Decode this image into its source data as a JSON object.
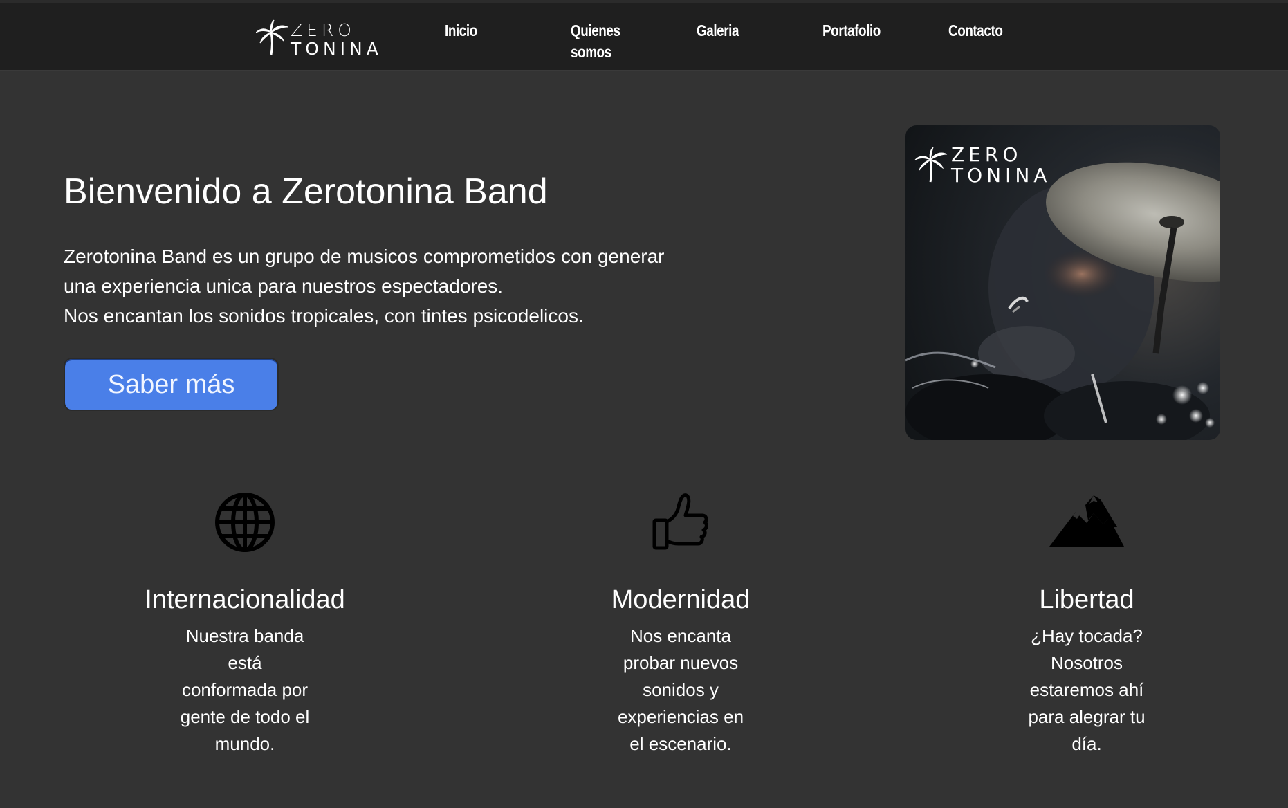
{
  "nav": {
    "brand": {
      "line1": "ZERO",
      "line2": "TONINA"
    },
    "items": [
      {
        "label": "Inicio"
      },
      {
        "label": "Quienes somos",
        "lines": [
          "Quienes",
          "somos"
        ]
      },
      {
        "label": "Galeria"
      },
      {
        "label": "Portafolio"
      },
      {
        "label": "Contacto"
      }
    ]
  },
  "hero": {
    "title": "Bienvenido a Zerotonina Band",
    "paragraph_lines": [
      "Zerotonina Band es un grupo de musicos comprometidos con generar",
      "una experiencia unica para nuestros espectadores.",
      "Nos encantan los sonidos tropicales, con tintes psicodelicos."
    ],
    "button_label": "Saber más",
    "photo_logo": {
      "line1": "ZERO",
      "line2": "TONINA"
    }
  },
  "features": [
    {
      "icon": "globe-icon",
      "title": "Internacionalidad",
      "text_lines": [
        "Nuestra banda",
        "está",
        "conformada por",
        "gente de todo el",
        "mundo."
      ]
    },
    {
      "icon": "thumbs-up-icon",
      "title": "Modernidad",
      "text_lines": [
        "Nos encanta",
        "probar nuevos",
        "sonidos y",
        "experiencias en",
        "el escenario."
      ]
    },
    {
      "icon": "mountains-icon",
      "title": "Libertad",
      "text_lines": [
        "¿Hay tocada?",
        "Nosotros",
        "estaremos ahí",
        "para alegrar tu",
        "día."
      ]
    }
  ],
  "colors": {
    "page_background": "#333333",
    "nav_background": "#1f1f1f",
    "button_blue": "#4a7fe8",
    "text": "#ffffff",
    "icon": "#000000"
  }
}
